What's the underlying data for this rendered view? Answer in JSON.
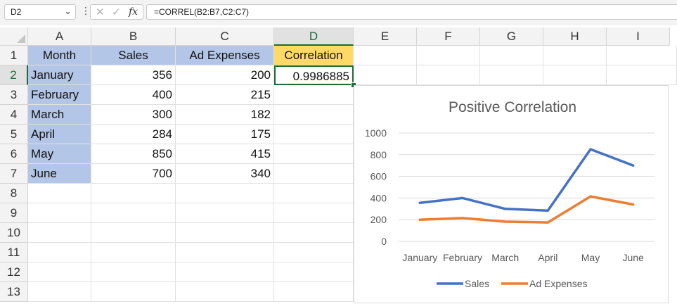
{
  "formula_bar": {
    "name_box": "D2",
    "name_box_arrow_icon": "chevron-down-icon",
    "fx_label": "fx",
    "formula": "=CORREL(B2:B7,C2:C7)"
  },
  "columns": [
    "A",
    "B",
    "C",
    "D",
    "E",
    "F",
    "G",
    "H",
    "I"
  ],
  "rows": [
    "1",
    "2",
    "3",
    "4",
    "5",
    "6",
    "7",
    "8",
    "9",
    "10",
    "11",
    "12",
    "13"
  ],
  "selected": {
    "column": "D",
    "row": "2"
  },
  "table": {
    "headers": {
      "month": "Month",
      "sales": "Sales",
      "ad": "Ad Expenses",
      "corr": "Correlation"
    },
    "data": [
      {
        "month": "January",
        "sales": "356",
        "ad": "200"
      },
      {
        "month": "February",
        "sales": "400",
        "ad": "215"
      },
      {
        "month": "March",
        "sales": "300",
        "ad": "182"
      },
      {
        "month": "April",
        "sales": "284",
        "ad": "175"
      },
      {
        "month": "May",
        "sales": "850",
        "ad": "415"
      },
      {
        "month": "June",
        "sales": "700",
        "ad": "340"
      }
    ],
    "correlation_value": "0.9986885"
  },
  "chart_data": {
    "type": "line",
    "title": "Positive Correlation",
    "categories": [
      "January",
      "February",
      "March",
      "April",
      "May",
      "June"
    ],
    "series": [
      {
        "name": "Sales",
        "values": [
          356,
          400,
          300,
          284,
          850,
          700
        ],
        "color": "#4472c4"
      },
      {
        "name": "Ad Expenses",
        "values": [
          200,
          215,
          182,
          175,
          415,
          340
        ],
        "color": "#ed7d31"
      }
    ],
    "ylim": [
      0,
      1000
    ],
    "yticks": [
      0,
      200,
      400,
      600,
      800,
      1000
    ],
    "grid": true,
    "legend": "bottom"
  }
}
